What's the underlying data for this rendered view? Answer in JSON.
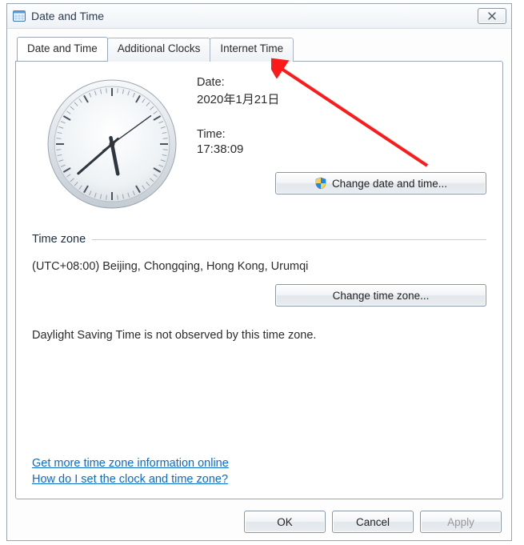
{
  "window": {
    "title": "Date and Time",
    "close_glyph": "⊠"
  },
  "tabs": [
    {
      "label": "Date and Time",
      "active": true
    },
    {
      "label": "Additional Clocks",
      "active": false
    },
    {
      "label": "Internet Time",
      "active": false
    }
  ],
  "date": {
    "label": "Date:",
    "value": "2020年1月21日"
  },
  "time": {
    "label": "Time:",
    "value": "17:38:09"
  },
  "buttons": {
    "change_datetime": "Change date and time...",
    "change_timezone": "Change time zone...",
    "ok": "OK",
    "cancel": "Cancel",
    "apply": "Apply"
  },
  "timezone": {
    "section_label": "Time zone",
    "value": "(UTC+08:00) Beijing, Chongqing, Hong Kong, Urumqi"
  },
  "dst_note": "Daylight Saving Time is not observed by this time zone.",
  "links": {
    "more_info": "Get more time zone information online",
    "how_to": "How do I set the clock and time zone?"
  },
  "clock": {
    "hour": 17,
    "minute": 38,
    "second": 9
  }
}
